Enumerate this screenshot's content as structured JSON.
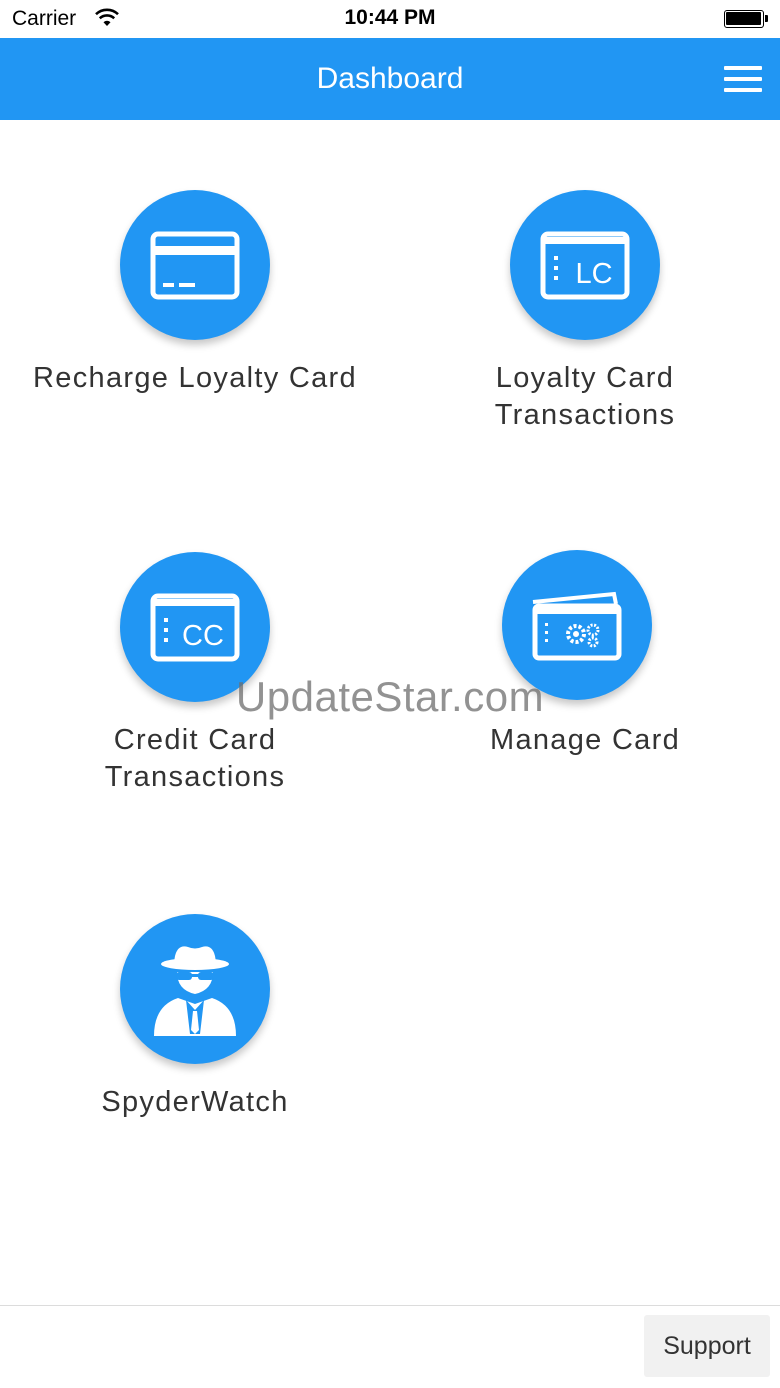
{
  "status_bar": {
    "carrier": "Carrier",
    "time": "10:44 PM"
  },
  "header": {
    "title": "Dashboard",
    "menu_icon": "hamburger-icon"
  },
  "tiles": [
    {
      "label": "Recharge Loyalty Card",
      "icon": "credit-card-icon"
    },
    {
      "label": "Loyalty Card\nTransactions",
      "icon": "lc-card-icon",
      "icon_text": "LC"
    },
    {
      "label": "Credit Card\nTransactions",
      "icon": "cc-card-icon",
      "icon_text": "CC"
    },
    {
      "label": "Manage Card",
      "icon": "card-gears-icon"
    },
    {
      "label": "SpyderWatch",
      "icon": "spy-icon"
    }
  ],
  "watermark": "UpdateStar.com",
  "footer": {
    "support_label": "Support"
  },
  "colors": {
    "primary": "#2196f3",
    "background": "#ffffff",
    "text": "#333333"
  }
}
